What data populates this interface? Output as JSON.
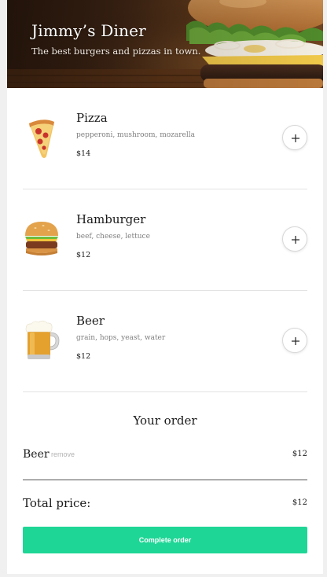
{
  "header": {
    "title": "Jimmy’s Diner",
    "subtitle": "The best burgers and pizzas in town."
  },
  "menu": {
    "items": [
      {
        "name": "Pizza",
        "ingredients": "pepperoni, mushroom, mozarella",
        "price": "$14",
        "icon": "pizza-icon",
        "add_icon": "plus-icon"
      },
      {
        "name": "Hamburger",
        "ingredients": "beef, cheese, lettuce",
        "price": "$12",
        "icon": "hamburger-icon",
        "add_icon": "plus-icon"
      },
      {
        "name": "Beer",
        "ingredients": "grain, hops, yeast, water",
        "price": "$12",
        "icon": "beer-icon",
        "add_icon": "plus-icon"
      }
    ]
  },
  "order": {
    "title": "Your order",
    "lines": [
      {
        "name": "Beer",
        "remove_label": "remove",
        "price": "$12"
      }
    ],
    "total_label": "Total price:",
    "total_value": "$12",
    "complete_label": "Complete order"
  },
  "colors": {
    "accent": "#1ed696",
    "divider": "#e3e3e3",
    "muted_text": "#808080"
  }
}
